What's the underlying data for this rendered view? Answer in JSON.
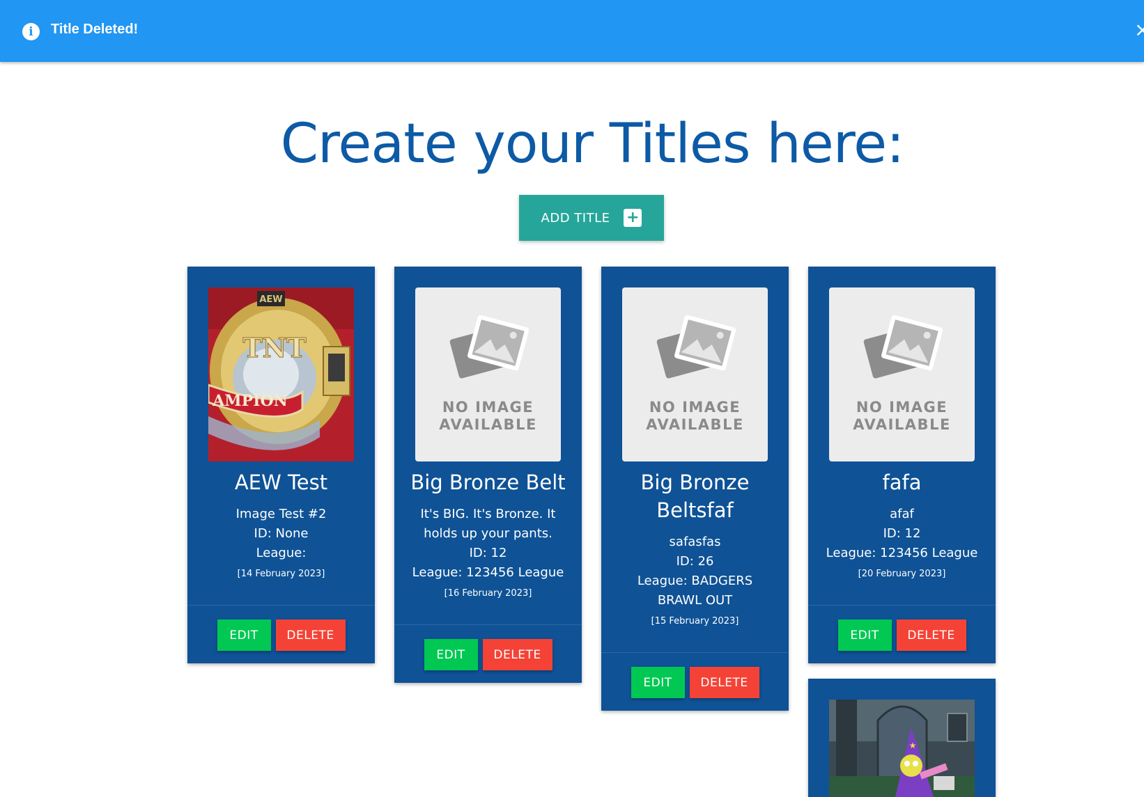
{
  "toast": {
    "icon": "info-icon",
    "message": "Title Deleted!",
    "close_symbol": "×"
  },
  "page": {
    "heading": "Create your Titles here:",
    "add_button_label": "ADD TITLE",
    "add_button_icon": "+"
  },
  "colors": {
    "toast_bg": "#2196f3",
    "heading": "#0d5aa6",
    "add_button": "#26a69a",
    "card_bg": "#0f5296",
    "edit_button": "#00c853",
    "delete_button": "#f44336"
  },
  "no_image": {
    "line1": "NO IMAGE",
    "line2": "AVAILABLE"
  },
  "cards": [
    {
      "image": "championship-belt-photo",
      "title": "AEW Test",
      "description": "Image Test #2",
      "id_text": "ID: None",
      "league_text": "League:",
      "date": "[14 February 2023]",
      "edit_label": "EDIT",
      "delete_label": "DELETE"
    },
    {
      "image": "no-image-placeholder",
      "title": "Big Bronze Belt",
      "description": "It's BIG. It's Bronze. It holds up your pants.",
      "id_text": "ID: 12",
      "league_text": "League: 123456 League",
      "date": "[16 February 2023]",
      "edit_label": "EDIT",
      "delete_label": "DELETE"
    },
    {
      "image": "no-image-placeholder",
      "title": "Big Bronze Beltsfaf",
      "description": "safasfas",
      "id_text": "ID: 26",
      "league_text": "League: BADGERS BRAWL OUT",
      "date": "[15 February 2023]",
      "edit_label": "EDIT",
      "delete_label": "DELETE"
    },
    {
      "image": "no-image-placeholder",
      "title": "fafa",
      "description": "afaf",
      "id_text": "ID: 12",
      "league_text": "League: 123456 League",
      "date": "[20 February 2023]",
      "edit_label": "EDIT",
      "delete_label": "DELETE"
    },
    {
      "image": "cartoon-wizard-photo"
    }
  ]
}
